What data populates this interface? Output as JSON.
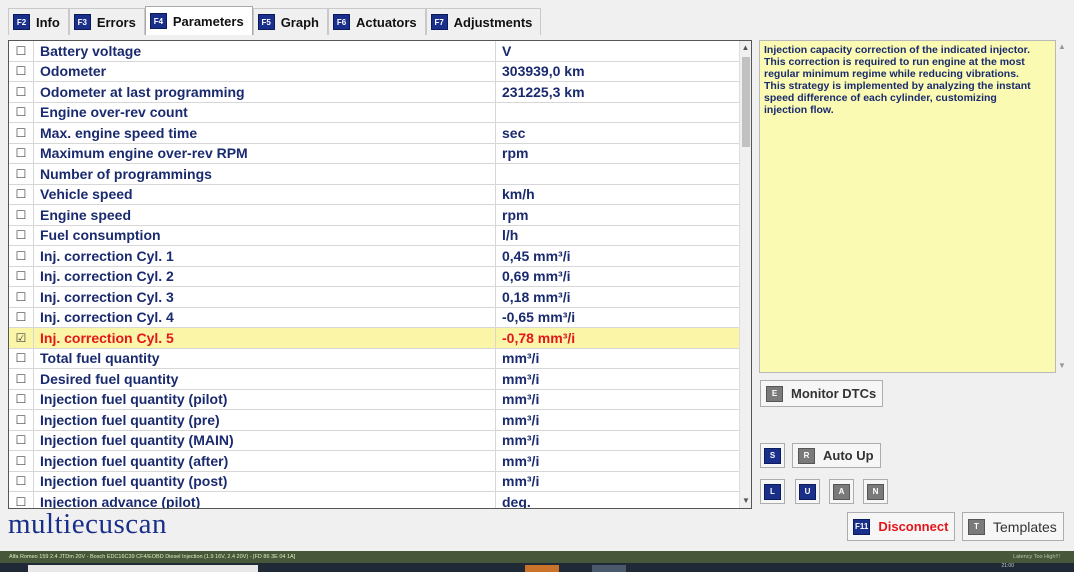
{
  "tabs": [
    {
      "key": "F2",
      "label": "Info"
    },
    {
      "key": "F3",
      "label": "Errors"
    },
    {
      "key": "F4",
      "label": "Parameters"
    },
    {
      "key": "F5",
      "label": "Graph"
    },
    {
      "key": "F6",
      "label": "Actuators"
    },
    {
      "key": "F7",
      "label": "Adjustments"
    }
  ],
  "active_tab": "Parameters",
  "checkbox_unchecked": "☐",
  "checkbox_checked": "☑",
  "parameters": [
    {
      "name": "Battery voltage",
      "value": "V",
      "checked": false
    },
    {
      "name": "Odometer",
      "value": "303939,0 km",
      "checked": false
    },
    {
      "name": "Odometer at last programming",
      "value": "231225,3 km",
      "checked": false
    },
    {
      "name": "Engine over-rev count",
      "value": "",
      "checked": false
    },
    {
      "name": "Max. engine speed time",
      "value": "sec",
      "checked": false
    },
    {
      "name": "Maximum engine over-rev RPM",
      "value": "rpm",
      "checked": false
    },
    {
      "name": "Number of programmings",
      "value": "",
      "checked": false
    },
    {
      "name": "Vehicle speed",
      "value": "km/h",
      "checked": false
    },
    {
      "name": "Engine speed",
      "value": "rpm",
      "checked": false
    },
    {
      "name": "Fuel consumption",
      "value": "l/h",
      "checked": false
    },
    {
      "name": "Inj. correction Cyl. 1",
      "value": "0,45 mm³/i",
      "checked": false
    },
    {
      "name": "Inj. correction Cyl. 2",
      "value": "0,69 mm³/i",
      "checked": false
    },
    {
      "name": "Inj. correction Cyl. 3",
      "value": "0,18 mm³/i",
      "checked": false
    },
    {
      "name": "Inj. correction Cyl. 4",
      "value": "-0,65 mm³/i",
      "checked": false
    },
    {
      "name": "Inj. correction Cyl. 5",
      "value": "-0,78 mm³/i",
      "checked": true
    },
    {
      "name": "Total fuel quantity",
      "value": "mm³/i",
      "checked": false
    },
    {
      "name": "Desired fuel quantity",
      "value": "mm³/i",
      "checked": false
    },
    {
      "name": "Injection fuel quantity (pilot)",
      "value": "mm³/i",
      "checked": false
    },
    {
      "name": "Injection fuel quantity (pre)",
      "value": "mm³/i",
      "checked": false
    },
    {
      "name": "Injection fuel quantity (MAIN)",
      "value": "mm³/i",
      "checked": false
    },
    {
      "name": "Injection fuel quantity (after)",
      "value": "mm³/i",
      "checked": false
    },
    {
      "name": "Injection fuel quantity (post)",
      "value": "mm³/i",
      "checked": false
    },
    {
      "name": "Injection advance (pilot)",
      "value": "deg.",
      "checked": false
    }
  ],
  "description": "Injection capacity correction of the indicated injector. This correction is required to run engine at the most regular minimum regime while reducing vibrations. This strategy is implemented by analyzing the instant speed difference of each cylinder, customizing injection flow.",
  "buttons": {
    "monitor_dtcs": {
      "key": "E",
      "label": "Monitor DTCs"
    },
    "s_key": "S",
    "auto_up": {
      "key": "R",
      "label": "Auto Up"
    },
    "l_key": "L",
    "u_key": "U",
    "a_key": "A",
    "n_key": "N",
    "disconnect": {
      "key": "F11",
      "label": "Disconnect"
    },
    "templates": {
      "key": "T",
      "label": "Templates"
    }
  },
  "logo": "multiecuscan",
  "status": {
    "vehicle": "Alfa Romeo 159 2.4 JTDm 20V - Bosch EDC16C39 CF4/EOBD Diesel Injection (1.9 16V, 2.4 20V) - [FD 86 3E 04 1A]",
    "latency": "Latency Too High!!!"
  },
  "taskbar_clock": "21:00",
  "colors": {
    "accent": "#1a2f8a",
    "selected_row": "#fbf5a8",
    "selected_text": "#e3161c",
    "description_bg": "#fafab2",
    "status_bg": "#47583a"
  }
}
